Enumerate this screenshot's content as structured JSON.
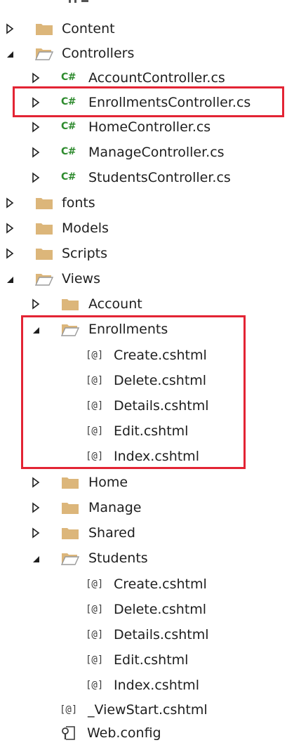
{
  "tree": {
    "content": "Content",
    "controllers": "Controllers",
    "account_controller": "AccountController.cs",
    "enrollments_controller": "EnrollmentsController.cs",
    "home_controller": "HomeController.cs",
    "manage_controller": "ManageController.cs",
    "students_controller": "StudentsController.cs",
    "fonts": "fonts",
    "models": "Models",
    "scripts": "Scripts",
    "views": "Views",
    "account": "Account",
    "enrollments": "Enrollments",
    "enr_create": "Create.cshtml",
    "enr_delete": "Delete.cshtml",
    "enr_details": "Details.cshtml",
    "enr_edit": "Edit.cshtml",
    "enr_index": "Index.cshtml",
    "home": "Home",
    "manage": "Manage",
    "shared": "Shared",
    "students": "Students",
    "stu_create": "Create.cshtml",
    "stu_delete": "Delete.cshtml",
    "stu_details": "Details.cshtml",
    "stu_edit": "Edit.cshtml",
    "stu_index": "Index.cshtml",
    "viewstart": "_ViewStart.cshtml",
    "webconfig": "Web.config"
  },
  "icons": {
    "cs_glyph": "C#",
    "razor_glyph": "[@]"
  },
  "colors": {
    "highlight_border": "#e32434",
    "folder": "#dcb67a",
    "cs_icon": "#2e8b2e"
  }
}
